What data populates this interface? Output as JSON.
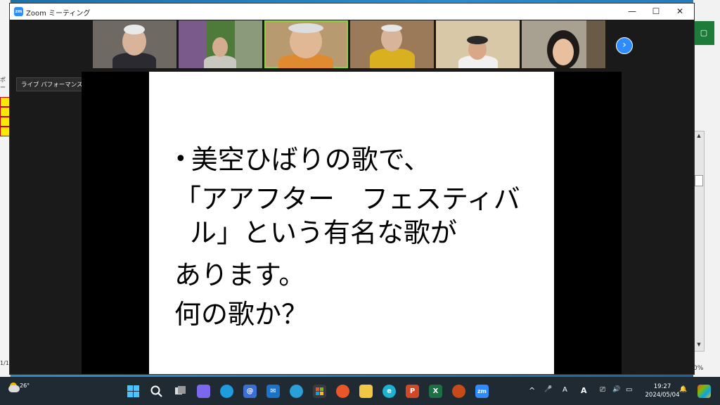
{
  "window": {
    "title": "Zoom ミーティング",
    "minimize_glyph": "—",
    "maximize_glyph": "☐",
    "close_glyph": "✕"
  },
  "app_icon_text": "zm",
  "tooltip": "ライブ パフォーマンス オーディオ: オフ",
  "next_page_glyph": "›",
  "participants": [
    {
      "id": "p1",
      "active": false
    },
    {
      "id": "p2",
      "active": false
    },
    {
      "id": "p3",
      "active": true
    },
    {
      "id": "p4",
      "active": false
    },
    {
      "id": "p5",
      "active": false
    },
    {
      "id": "p6",
      "active": false
    }
  ],
  "slide": {
    "bullet": "•",
    "lines": [
      "美空ひばりの歌で、",
      "「アアフター　フェスティバ",
      "ル」という有名な歌が",
      "あります。",
      "何の歌か？"
    ]
  },
  "background_app": {
    "left_label_1": "ポー",
    "left_label_2": "1/1",
    "right_zoom_pct": "0%",
    "accent": "#1e7b3a"
  },
  "taskbar": {
    "temperature": "26°",
    "time": "19:27",
    "date": "2024/05/04",
    "icons": [
      "start-icon",
      "search-icon",
      "task-view-icon",
      "chat-icon",
      "edge-icon",
      "mail-at-icon",
      "mail-icon",
      "browser-icon",
      "store-icon",
      "app-red-icon",
      "file-explorer-icon",
      "edge-dev-icon",
      "powerpoint-icon",
      "excel-icon",
      "app-flower-icon",
      "zoom-icon"
    ],
    "tray_glyphs": {
      "up": "^",
      "mic": "🎤",
      "pen": "A",
      "office": "A",
      "net": "⎚",
      "vol": "🔊",
      "bat": "▭",
      "bell": "🔔"
    }
  }
}
